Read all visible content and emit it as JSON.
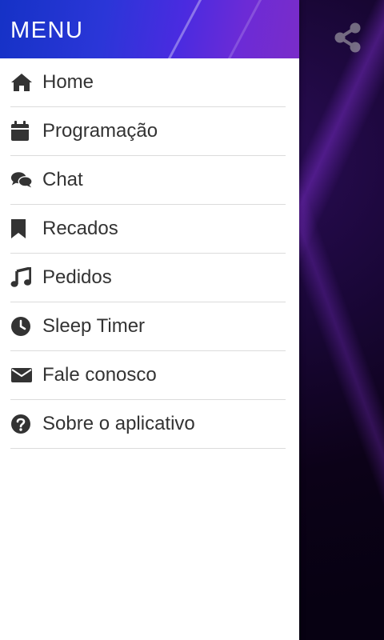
{
  "header": {
    "title": "MENU"
  },
  "menu": {
    "items": [
      {
        "label": "Home",
        "icon": "home-icon"
      },
      {
        "label": "Programação",
        "icon": "calendar-icon"
      },
      {
        "label": "Chat",
        "icon": "chat-icon"
      },
      {
        "label": "Recados",
        "icon": "bookmark-icon"
      },
      {
        "label": "Pedidos",
        "icon": "music-note-icon"
      },
      {
        "label": "Sleep Timer",
        "icon": "clock-icon"
      },
      {
        "label": "Fale conosco",
        "icon": "envelope-icon"
      },
      {
        "label": "Sobre o aplicativo",
        "icon": "question-circle-icon"
      }
    ]
  },
  "actions": {
    "share_icon": "share-icon"
  },
  "colors": {
    "header_gradient_start": "#1532c6",
    "header_gradient_end": "#7a2cc9",
    "text": "#333333",
    "divider": "#dcdcdc"
  }
}
